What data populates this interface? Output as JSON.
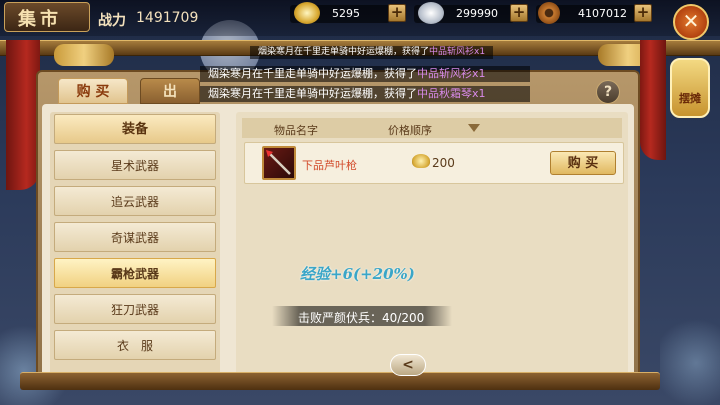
{
  "header": {
    "title": "集市",
    "power_label": "战力",
    "power_value": "1491709"
  },
  "currencies": [
    {
      "name": "gold-ingot-icon",
      "value": "5295"
    },
    {
      "name": "silver-ingot-icon",
      "value": "299990"
    },
    {
      "name": "copper-coin-icon",
      "value": "4107012"
    }
  ],
  "notices": {
    "top_prefix": "烟染寒月在千里走单骑中好运爆棚，获得了",
    "top_item": "中品斩风衫x1",
    "line1_prefix": "烟染寒月在千里走单骑中好运爆棚，获得了",
    "line1_item": "中品斩风衫x1",
    "line2_prefix": "烟染寒月在千里走单骑中好运爆棚，获得了",
    "line2_item": "中品秋霜琴x1"
  },
  "tabs": {
    "buy": "购 买",
    "sell": "出"
  },
  "side_badge": "摆摊",
  "help": "?",
  "categories": {
    "header": "装备",
    "items": [
      "星术武器",
      "追云武器",
      "奇谋武器",
      "霸枪武器",
      "狂刀武器",
      "衣　服"
    ],
    "active": "霸枪武器"
  },
  "list": {
    "col_name": "物品名字",
    "col_price": "价格顺序",
    "rows": [
      {
        "name": "下品芦叶枪",
        "price": "200",
        "button": "购 买"
      }
    ]
  },
  "floating": {
    "exp": "经验+6(+20%)",
    "quest": "击败严颜伏兵：40/200"
  },
  "pager": "<"
}
